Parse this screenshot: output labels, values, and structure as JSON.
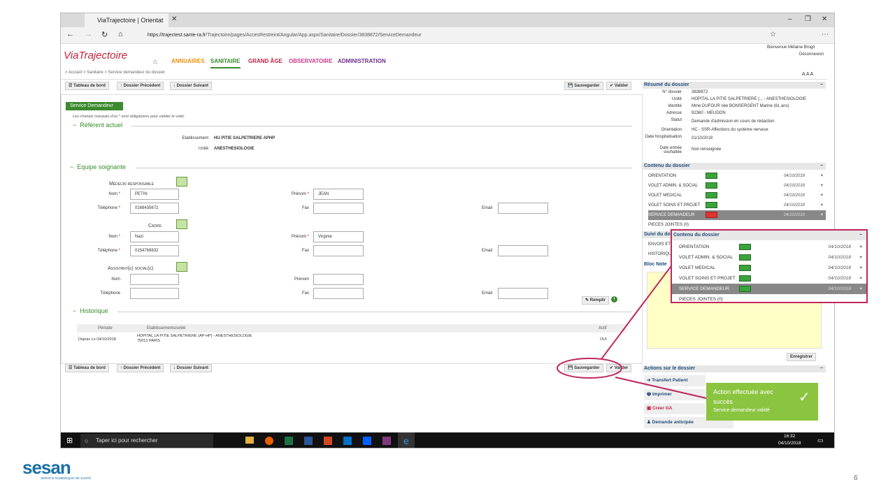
{
  "browser": {
    "tab_title": "ViaTrajectoire | Orientat",
    "url_host": "https://trajectest.sante-ra.fr",
    "url_path": "/Trajectoire/pages/AccesRestreint/Angular/App.aspx/Sanitaire/Dossier/3838872/ServiceDemandeur"
  },
  "header": {
    "logo_text": "ViaTrajectoire",
    "welcome": "Bienvenue Mélaine Brogli",
    "logout": "Déconnexion",
    "nav": [
      "ANNUAIRES",
      "SANITAIRE",
      "GRAND ÂGE",
      "OBSERVATOIRE",
      "ADMINISTRATION"
    ],
    "breadcrumb": "> Accueil > Sanitaire > Service demandeur du dossier",
    "text_size": "A A A"
  },
  "toolbar": {
    "dashboard": "Tableau de bord",
    "previous": "Dossier Précédent",
    "next": "Dossier Suivant",
    "save": "Sauvegarder",
    "validate": "Valider"
  },
  "form": {
    "tab_label": "Service Demandeur",
    "required_note": "Les champs marqués d'un * sont obligatoires pour valider le volet.",
    "referent_title": "Référent actuel",
    "etablissement_label": "Etablissement",
    "etablissement_value": "HU PITIE SALPETRIERE APHP",
    "unite_label": "Unité",
    "unite_value": "ANESTHESIOLOGIE",
    "equipe_title": "Equipe soignante",
    "medecin_title": "Médecin responsable",
    "cadre_title": "Cadre",
    "assistant_title": "Assistant(e) social(e)",
    "nom_label": "Nom",
    "prenom_label": "Prénom",
    "telephone_label": "Téléphone",
    "fax_label": "Fax",
    "email_label": "Email",
    "medecin": {
      "nom": "PETIN",
      "prenom": "JEAN",
      "telephone": "0168435672"
    },
    "cadre": {
      "nom": "Nazi",
      "prenom": "Virginie",
      "telephone": "0154769832"
    },
    "remplir": "Remplir",
    "historique_title": "Historique",
    "hist_headers": [
      "Période",
      "Etablissements/unité",
      "Actif"
    ],
    "hist_row": {
      "periode": "Depuis Le 04/10/2018",
      "etab_line1": "HOPITAL LA PITIE SALPETRIERE (AP-HP) - ANESTHESIOLOGIE",
      "etab_line2": "75013 PARIS",
      "actif": "OUI"
    }
  },
  "resume": {
    "title": "Résumé du dossier",
    "fields": [
      {
        "label": "N° dossier",
        "value": "3838872"
      },
      {
        "label": "Unité",
        "value": "HOPITAL LA PITIE SALPETRIERE (... - ANESTHESIOLOGIE"
      },
      {
        "label": "Identité",
        "value": "Mme DUFOUR née BONSERGENT Marine (61 ans)"
      },
      {
        "label": "Adresse",
        "value": "92360 - MEUDON"
      },
      {
        "label": "Statut",
        "value": "Demande d'admission en cours de rédaction"
      },
      {
        "label": "Orientation",
        "value": "HC - SSR-Affections du système nerveux"
      },
      {
        "label": "Date hospitalisation",
        "value": "01/10/2018"
      },
      {
        "label": "Date entrée souhaitée",
        "value": "Non renseignée"
      }
    ]
  },
  "contenu": {
    "title": "Contenu du dossier",
    "items": [
      {
        "label": "ORIENTATION",
        "date": "04/10/2018"
      },
      {
        "label": "VOLET ADMIN. & SOCIAL",
        "date": "04/10/2018"
      },
      {
        "label": "VOLET MEDICAL",
        "date": "04/10/2018"
      },
      {
        "label": "VOLET SOINS ET PROJET",
        "date": "04/10/2018"
      },
      {
        "label": "SERVICE DEMANDEUR",
        "date": "04/10/2018"
      }
    ],
    "pieces": "PIECES JOINTES (0)"
  },
  "suivi": {
    "title": "Suivi du do",
    "items": [
      "ENVOIS ET",
      "HISTORIQU"
    ]
  },
  "bloc_notes": {
    "title": "Bloc Note",
    "save": "Enregistrer"
  },
  "actions": {
    "title": "Actions sur le dossier",
    "items": [
      "Transfert Patient",
      "Imprimer",
      "Créer GA",
      "Demande anticipée"
    ]
  },
  "toast": {
    "title": "Action effectuée avec succès",
    "subtitle": "Service demandeur validé"
  },
  "taskbar": {
    "search": "Taper ici pour rechercher",
    "time": "16:32",
    "date": "04/10/2018"
  },
  "slide": {
    "logo": "sesan",
    "logo_sub": "SERVICE NUMÉRIQUE DE SANTÉ",
    "page_number": "6"
  },
  "colors": {
    "accent_green": "#3b8a2e",
    "nav_orange": "#e8930c",
    "popup_border": "#c0275f",
    "toast_green": "#8bc43f"
  }
}
